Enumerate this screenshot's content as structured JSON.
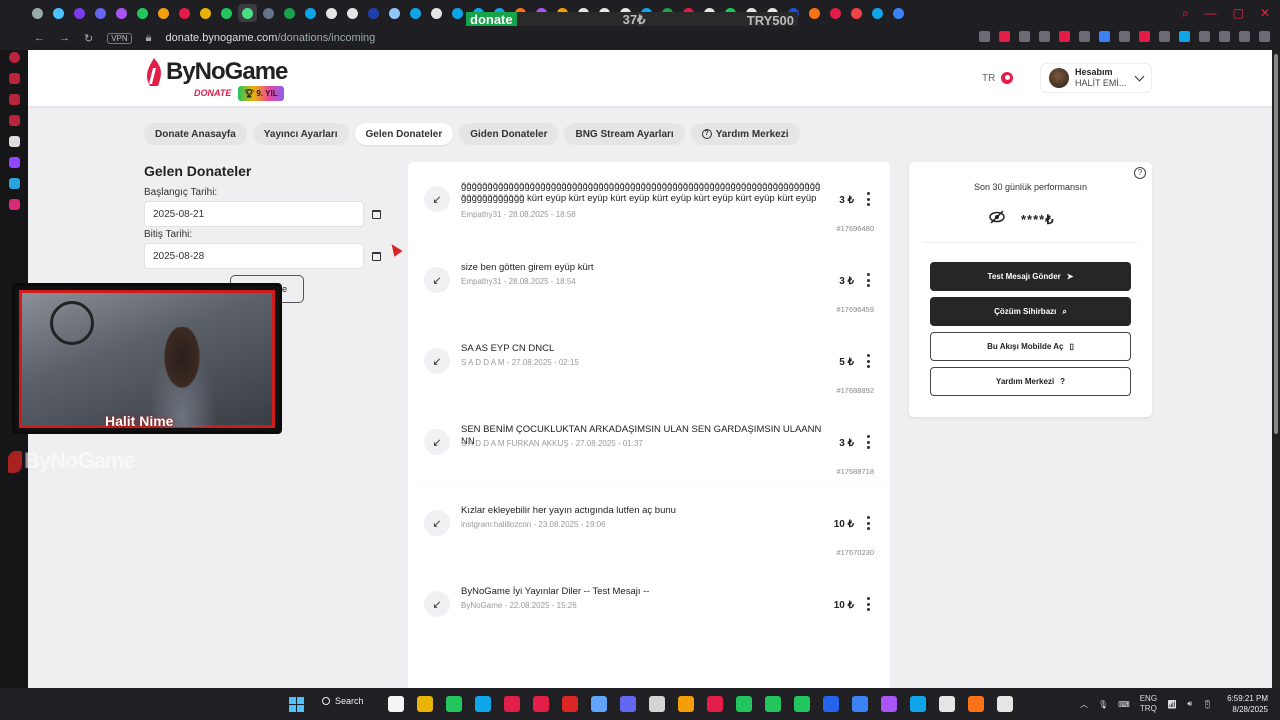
{
  "browser": {
    "ticker": {
      "label": "donate",
      "amount": "37₺",
      "target": "TRY500"
    },
    "vpn_badge": "VPN",
    "url_domain": "donate.bynogame.com",
    "url_path": "/donations/incoming",
    "tab_colors": [
      "#9aa",
      "#4cc2ff",
      "#7c3aed",
      "#6366f1",
      "#a855f7",
      "#22c55e",
      "#f59e0b",
      "#e11d48",
      "#eab308",
      "#22c55e",
      "#4ade80",
      "#64748b",
      "#16a34a",
      "#0ea5e9",
      "#e5e5e5",
      "#e5e5e5",
      "#1e40af",
      "#93c5fd",
      "#0ea5e9",
      "#e5e5e5",
      "#0ea5e9",
      "#0ea5e9",
      "#0ea5e9",
      "#f97316",
      "#a855f7",
      "#f59e0b",
      "#e5e5e5",
      "#e5e5e5",
      "#e5e5e5",
      "#0ea5e9",
      "#16a34a",
      "#e11d48",
      "#e5e5e5",
      "#22c55e",
      "#e5e5e5",
      "#e5e5e5",
      "#1d4ed8",
      "#f97316",
      "#e11d48",
      "#ef4444",
      "#0ea5e9",
      "#3b82f6"
    ]
  },
  "header": {
    "logo_text": "ByNoGame",
    "logo_sub": "DONATE",
    "year_badge": "9. YIL",
    "lang": "TR",
    "account_title": "Hesabım",
    "account_name": "HALİT EMİ..."
  },
  "nav": [
    {
      "label": "Donate Anasayfa",
      "active": false
    },
    {
      "label": "Yayıncı Ayarları",
      "active": false
    },
    {
      "label": "Gelen Donateler",
      "active": true
    },
    {
      "label": "Giden Donateler",
      "active": false
    },
    {
      "label": "BNG Stream Ayarları",
      "active": false
    },
    {
      "label": "Yardım Merkezi",
      "active": false,
      "icon": "question-icon"
    }
  ],
  "filters": {
    "title": "Gelen Donateler",
    "start_label": "Başlangıç Tarihi:",
    "start_value": "2025-08-21",
    "end_label": "Bitiş Tarihi:",
    "end_value": "2025-08-28",
    "filter_button": "e"
  },
  "donations": [
    {
      "message": "ğğğğğğğğğğğğğğğğğğğğğğğğğğğğğğğğğğğğğğğğğğğğğğğğğğğğğğğğğğğğğğğğğğğğğğğğğğğğğğğğ kürt eyüp kürt eyüp kürt eyüp kürt eyüp kürt eyüp kürt eyüp kürt eyüp kürt eyüp üç bir",
      "sender": "Empathy31",
      "date": "28.08.2025 - 18:58",
      "amount": "3 ₺",
      "id": "#17696480"
    },
    {
      "message": "size ben götten girem eyüp kürt",
      "sender": "Empathy31",
      "date": "28.08.2025 - 18:54",
      "amount": "3 ₺",
      "id": "#17696459"
    },
    {
      "message": "SA AS EYP CN DNCL",
      "sender": "S A D D A M",
      "date": "27.08.2025 - 02:15",
      "amount": "5 ₺",
      "id": "#17688892"
    },
    {
      "message": "SEN BENİM ÇOCUKLUKTAN ARKADAŞIMSIN ULAN SEN GARDAŞIMSIN ULAANNNN",
      "sender": "S A D D A M FURKAN AKKUŞ",
      "date": "27.08.2025 - 01:37",
      "amount": "3 ₺",
      "id": "#17688718"
    },
    {
      "message": "Kızlar ekleyebilir her yayın actıgında lutfen aç bunu",
      "sender": "instgram:halillozcnn",
      "date": "23.08.2025 - 19:06",
      "amount": "10 ₺",
      "id": "#17670230"
    },
    {
      "message": "ByNoGame İyi Yayınlar Diler -- Test Mesajı --",
      "sender": "ByNoGame",
      "date": "22.08.2025 - 15:26",
      "amount": "10 ₺",
      "id": ""
    }
  ],
  "panel": {
    "perf_label": "Son 30 günlük performansın",
    "perf_value": "****₺",
    "help": "?",
    "buttons": [
      {
        "label": "Test Mesajı Gönder",
        "style": "dark",
        "icon": "send-icon"
      },
      {
        "label": "Çözüm Sihirbazı",
        "style": "dark",
        "icon": "magnifier-icon"
      },
      {
        "label": "Bu Akışı Mobilde Aç",
        "style": "light",
        "icon": "phone-icon"
      },
      {
        "label": "Yardım Merkezi",
        "style": "light",
        "icon": "question-icon"
      }
    ]
  },
  "stream": {
    "cam_name": "Halit Nime",
    "overlay_logo": "ByNoGame"
  },
  "taskbar": {
    "search": "Search",
    "lang_top": "ENG",
    "lang_bottom": "TRQ",
    "time": "6:59:21 PM",
    "date": "8/28/2025",
    "icon_colors": [
      "#f5f5f5",
      "#eab308",
      "#22c55e",
      "#0ea5e9",
      "#e11d48",
      "#e11d48",
      "#dc2626",
      "#60a5fa",
      "#6366f1",
      "#d4d4d4",
      "#f59e0b",
      "#e11d48",
      "#22c55e",
      "#22c55e",
      "#22c55e",
      "#2563eb",
      "#3b82f6",
      "#a855f7",
      "#0ea5e9",
      "#e5e5e5",
      "#f97316",
      "#e5e5e5"
    ]
  },
  "colors": {
    "brand_red": "#e11d48",
    "dark_button": "#262626"
  }
}
